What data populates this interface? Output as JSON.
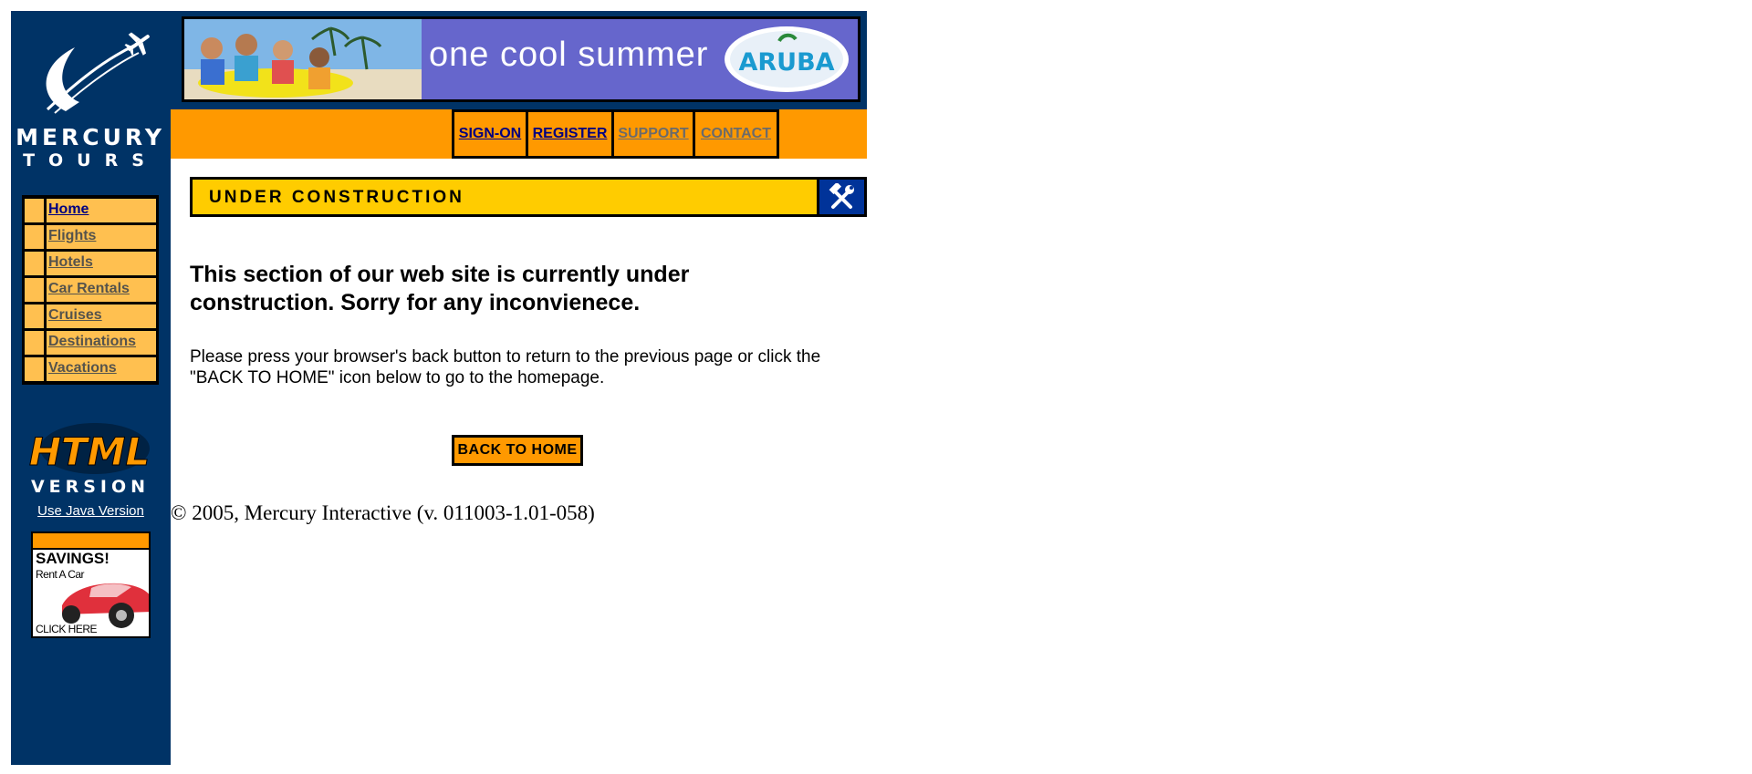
{
  "brand": {
    "logo_line1": "MERCURY",
    "logo_line2": "TOURS"
  },
  "banner": {
    "tagline": "one cool summer",
    "sponsor": "ARUBA"
  },
  "top_nav": [
    {
      "label": "SIGN-ON",
      "style": "dark"
    },
    {
      "label": "REGISTER",
      "style": "dark"
    },
    {
      "label": "SUPPORT",
      "style": "gray"
    },
    {
      "label": "CONTACT",
      "style": "gray"
    }
  ],
  "side_nav": [
    {
      "label": "Home",
      "active": true
    },
    {
      "label": "Flights",
      "active": false
    },
    {
      "label": "Hotels",
      "active": false
    },
    {
      "label": "Car Rentals",
      "active": false
    },
    {
      "label": "Cruises",
      "active": false
    },
    {
      "label": "Destinations",
      "active": false
    },
    {
      "label": "Vacations",
      "active": false
    }
  ],
  "html_version": {
    "line1": "HTML",
    "line2": "VERSION"
  },
  "java_link": "Use Java Version",
  "savings_ad": {
    "title": "SAVINGS!",
    "subtitle": "Rent A Car",
    "cta": "CLICK HERE"
  },
  "under_construction": {
    "title": "UNDER CONSTRUCTION",
    "icon": "tools-icon"
  },
  "content": {
    "headline": "This section of our web site is currently under construction.   Sorry for any inconvienece.",
    "instructions": "Please press your browser's back button to return to the previous page or click the \"BACK TO HOME\" icon below to go to the homepage.",
    "back_button": "BACK TO HOME"
  },
  "footer": {
    "copyright": "© 2005, Mercury Interactive (v. 011003-1.01-058)"
  },
  "colors": {
    "navy": "#003366",
    "orange": "#FF9900",
    "light_orange": "#FFC050",
    "yellow": "#FFCC00",
    "banner_purple": "#6666CC"
  }
}
